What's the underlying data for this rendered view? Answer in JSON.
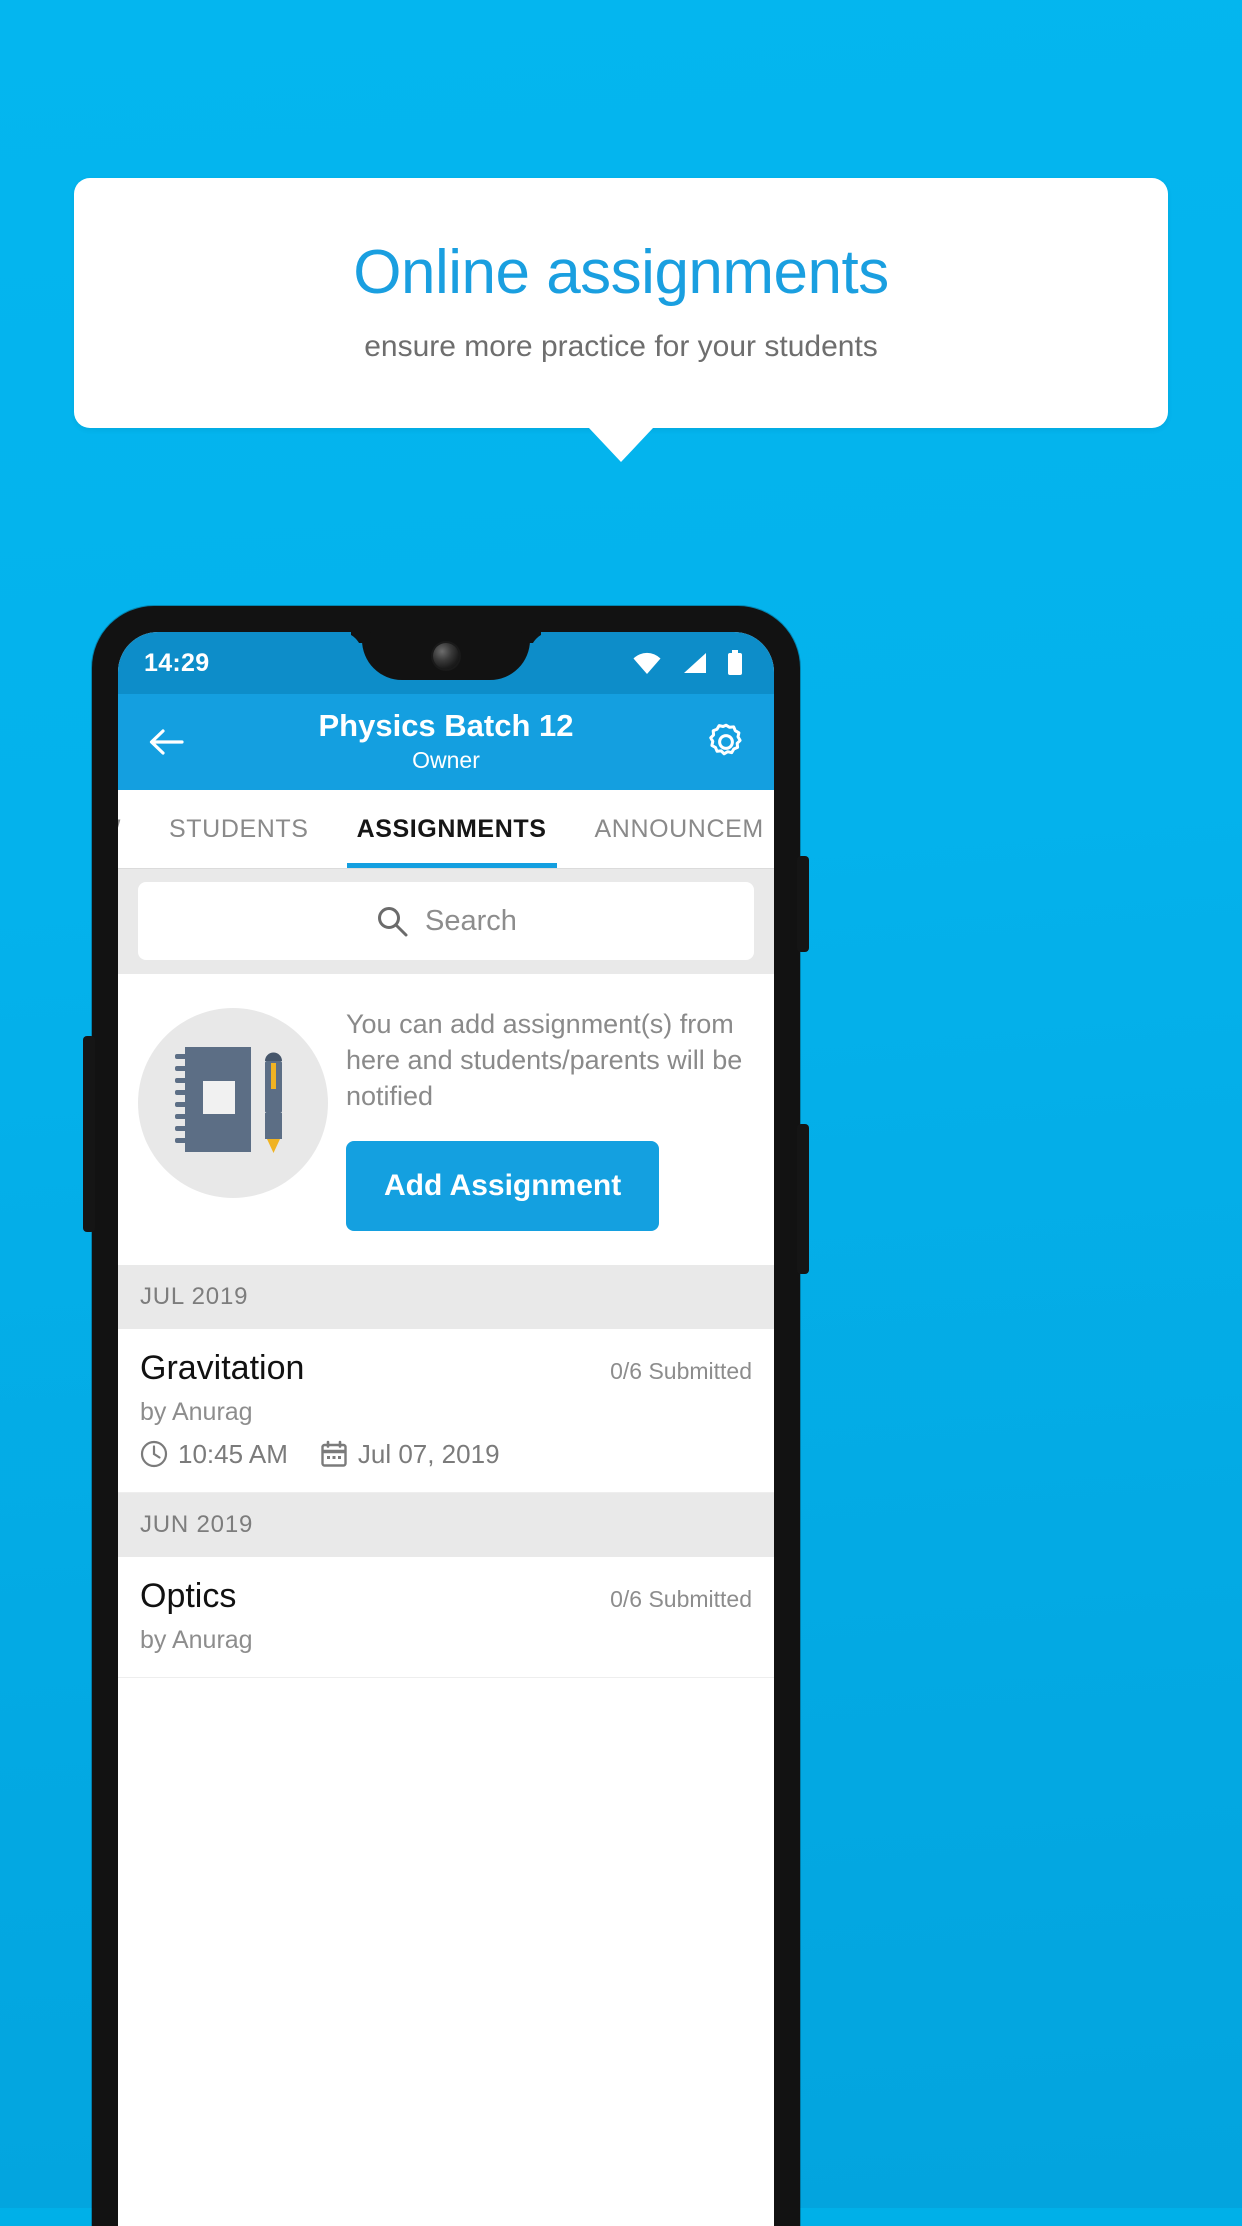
{
  "promo": {
    "headline": "Online assignments",
    "subheadline": "ensure more practice for your students",
    "background_color": "#04b2ec",
    "headline_color": "#1a9fe0"
  },
  "phone": {
    "status_bar": {
      "time": "14:29",
      "icons": [
        "wifi-icon",
        "signal-icon",
        "battery-icon"
      ],
      "background_color": "#0d8dc9"
    },
    "app_bar": {
      "back_icon": "back-arrow-icon",
      "title": "Physics Batch 12",
      "subtitle": "Owner",
      "settings_icon": "gear-icon",
      "background_color": "#149fe0"
    },
    "tabs": [
      {
        "label": "IEW",
        "active": false
      },
      {
        "label": "STUDENTS",
        "active": false
      },
      {
        "label": "ASSIGNMENTS",
        "active": true
      },
      {
        "label": "ANNOUNCEM",
        "active": false
      }
    ],
    "search": {
      "icon": "search-icon",
      "placeholder": "Search",
      "value": ""
    },
    "empty_state": {
      "illustration": "notebook-and-pen-icon",
      "message": "You can add assignment(s) from here and students/parents will be notified",
      "button_label": "Add Assignment",
      "button_color": "#14a0e0"
    },
    "groups": [
      {
        "month": "JUL 2019",
        "items": [
          {
            "title": "Gravitation",
            "status": "0/6 Submitted",
            "author": "by Anurag",
            "time_icon": "clock-icon",
            "time": "10:45 AM",
            "date_icon": "calendar-icon",
            "date": "Jul 07, 2019"
          }
        ]
      },
      {
        "month": "JUN 2019",
        "items": [
          {
            "title": "Optics",
            "status": "0/6 Submitted",
            "author": "by Anurag",
            "time_icon": "clock-icon",
            "time": "",
            "date_icon": "calendar-icon",
            "date": ""
          }
        ]
      }
    ]
  }
}
